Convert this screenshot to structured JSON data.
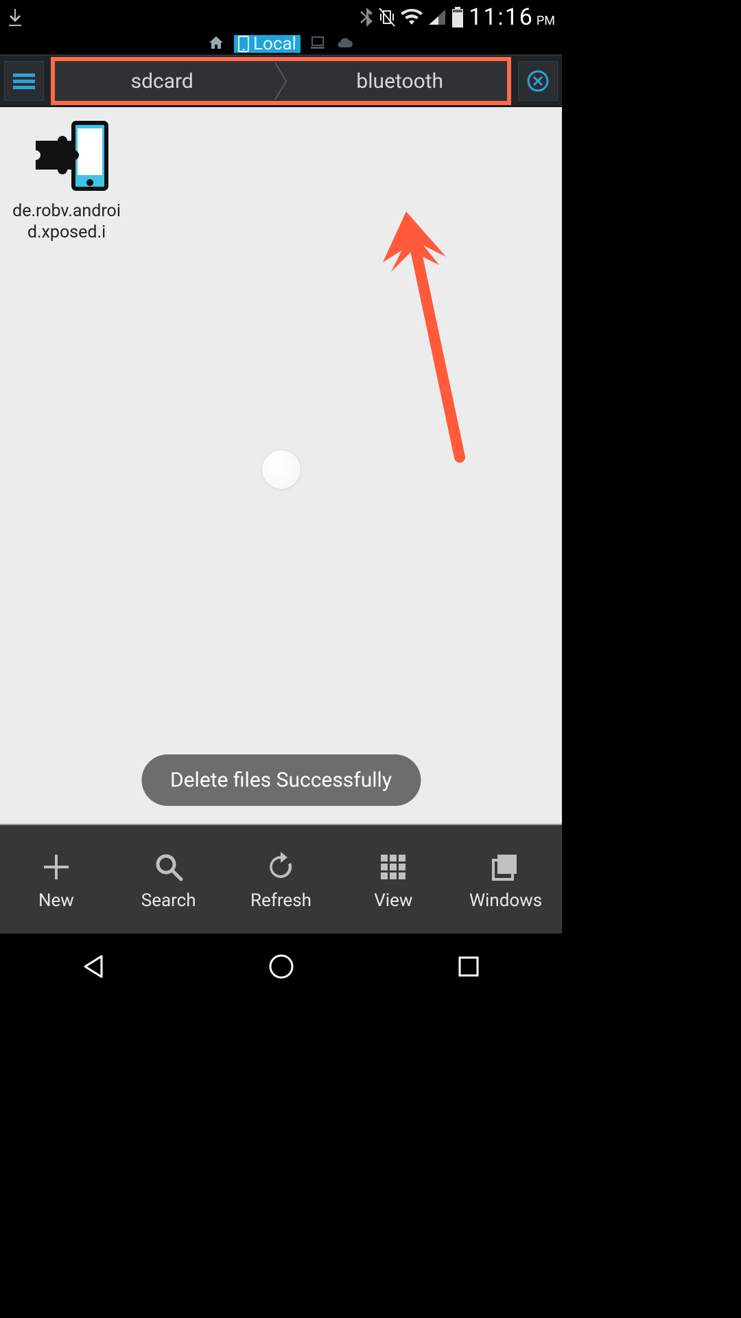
{
  "status": {
    "time": "11:16",
    "ampm": "PM"
  },
  "tabs": {
    "local_label": "Local"
  },
  "breadcrumb": {
    "items": [
      "sdcard",
      "bluetooth"
    ]
  },
  "files": [
    {
      "name": "de.robv.android.xposed.i"
    }
  ],
  "toast": "Delete files Successfully",
  "bottom": [
    {
      "label": "New"
    },
    {
      "label": "Search"
    },
    {
      "label": "Refresh"
    },
    {
      "label": "View"
    },
    {
      "label": "Windows"
    }
  ],
  "colors": {
    "highlight": "#ff6b4a",
    "accent": "#1ea4dc"
  }
}
